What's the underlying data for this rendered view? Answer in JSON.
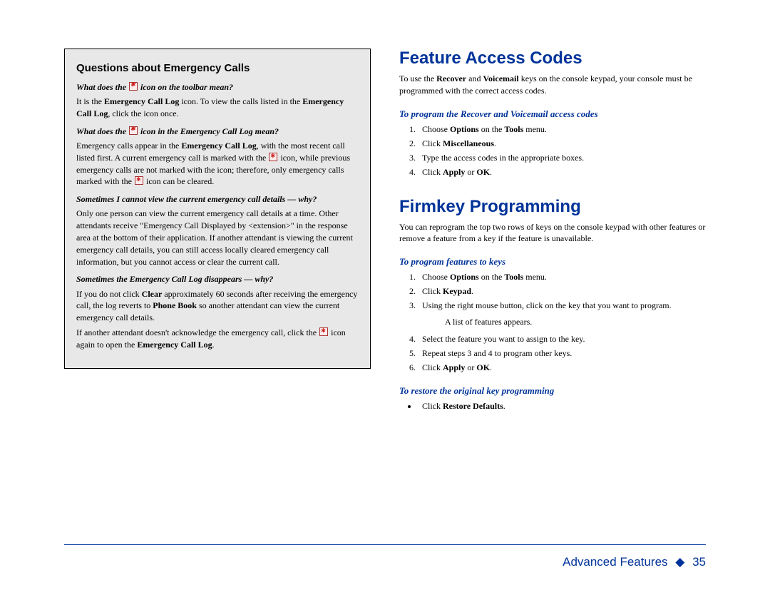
{
  "left": {
    "box_title": "Questions about Emergency Calls",
    "q1": {
      "question_pre": "What does the",
      "question_post": "icon on the toolbar mean?",
      "a_pre": "It is the",
      "a_bold1": "Emergency Call Log",
      "a_mid": "icon. To view the calls listed in the",
      "a_bold2": "Emergency Call Log",
      "a_post": ", click the icon once."
    },
    "q2": {
      "question_pre": "What does the",
      "question_post": "icon in the Emergency Call Log mean?",
      "a_pre": "Emergency calls appear in the",
      "a_bold1": "Emergency Call Log",
      "a_post": ", with the most recent call listed first. A current emergency call is marked with the",
      "a_post2": "icon, while previous emergency calls are not marked with the icon; therefore, only emergency calls marked with the",
      "a_post3": "icon can be cleared."
    },
    "q3": {
      "question": "Sometimes I cannot view the current emergency call details — why?",
      "answer": "Only one person can view the current emergency call details at a time. Other attendants receive \"Emergency Call Displayed by <extension>\" in the response area at the bottom of their application. If another attendant is viewing the current emergency call details, you can still access locally cleared emergency call information, but you cannot access or clear the current call."
    },
    "q4": {
      "question": "Sometimes the Emergency Call Log disappears — why?",
      "a1_pre": "If you do not click",
      "a1_bold1": "Clear",
      "a1_mid": "approximately 60 seconds after receiving the emergency call, the log reverts to",
      "a1_bold2": "Phone Book",
      "a1_post": "so another attendant can view the current emergency call details.",
      "a2_pre": "If another attendant doesn't acknowledge the emergency call, click the",
      "a2_mid": "icon again to open the",
      "a2_bold": "Emergency Call Log",
      "a2_post": "."
    }
  },
  "right": {
    "sec1_title": "Feature Access Codes",
    "sec1_intro_pre": "To use the",
    "sec1_intro_b1": "Recover",
    "sec1_intro_and": "and",
    "sec1_intro_b2": "Voicemail",
    "sec1_intro_post": "keys on the console keypad, your console must be programmed with the correct access codes.",
    "sec1_sub": "To program the Recover and Voicemail access codes",
    "sec1_steps": {
      "s1_pre": "Choose",
      "s1_b1": "Options",
      "s1_mid": "on the",
      "s1_b2": "Tools",
      "s1_post": "menu.",
      "s2_pre": "Click",
      "s2_b": "Miscellaneous",
      "s2_post": ".",
      "s3": "Type the access codes in the appropriate boxes.",
      "s4_pre": "Click",
      "s4_b1": "Apply",
      "s4_mid": "or",
      "s4_b2": "OK",
      "s4_post": "."
    },
    "sec2_title": "Firmkey Programming",
    "sec2_intro": "You can reprogram the top two rows of keys on the console keypad with other features or remove a feature from a key if the feature is unavailable.",
    "sec2_sub": "To program features to keys",
    "sec2_steps": {
      "s1_pre": "Choose",
      "s1_b1": "Options",
      "s1_mid": "on the",
      "s1_b2": "Tools",
      "s1_post": "menu.",
      "s2_pre": "Click",
      "s2_b": "Keypad",
      "s2_post": ".",
      "s3": "Using the right mouse button, click on the key that you want to program.",
      "s3_note": "A list of features appears.",
      "s4": "Select the feature you want to assign to the key.",
      "s5": "Repeat steps 3 and 4 to program other keys.",
      "s6_pre": "Click",
      "s6_b1": "Apply",
      "s6_mid": "or",
      "s6_b2": "OK",
      "s6_post": "."
    },
    "sec2_sub2": "To restore the original key programming",
    "sec2_bul_pre": "Click",
    "sec2_bul_b": "Restore Defaults",
    "sec2_bul_post": "."
  },
  "footer": {
    "label": "Advanced Features",
    "page": "35"
  }
}
